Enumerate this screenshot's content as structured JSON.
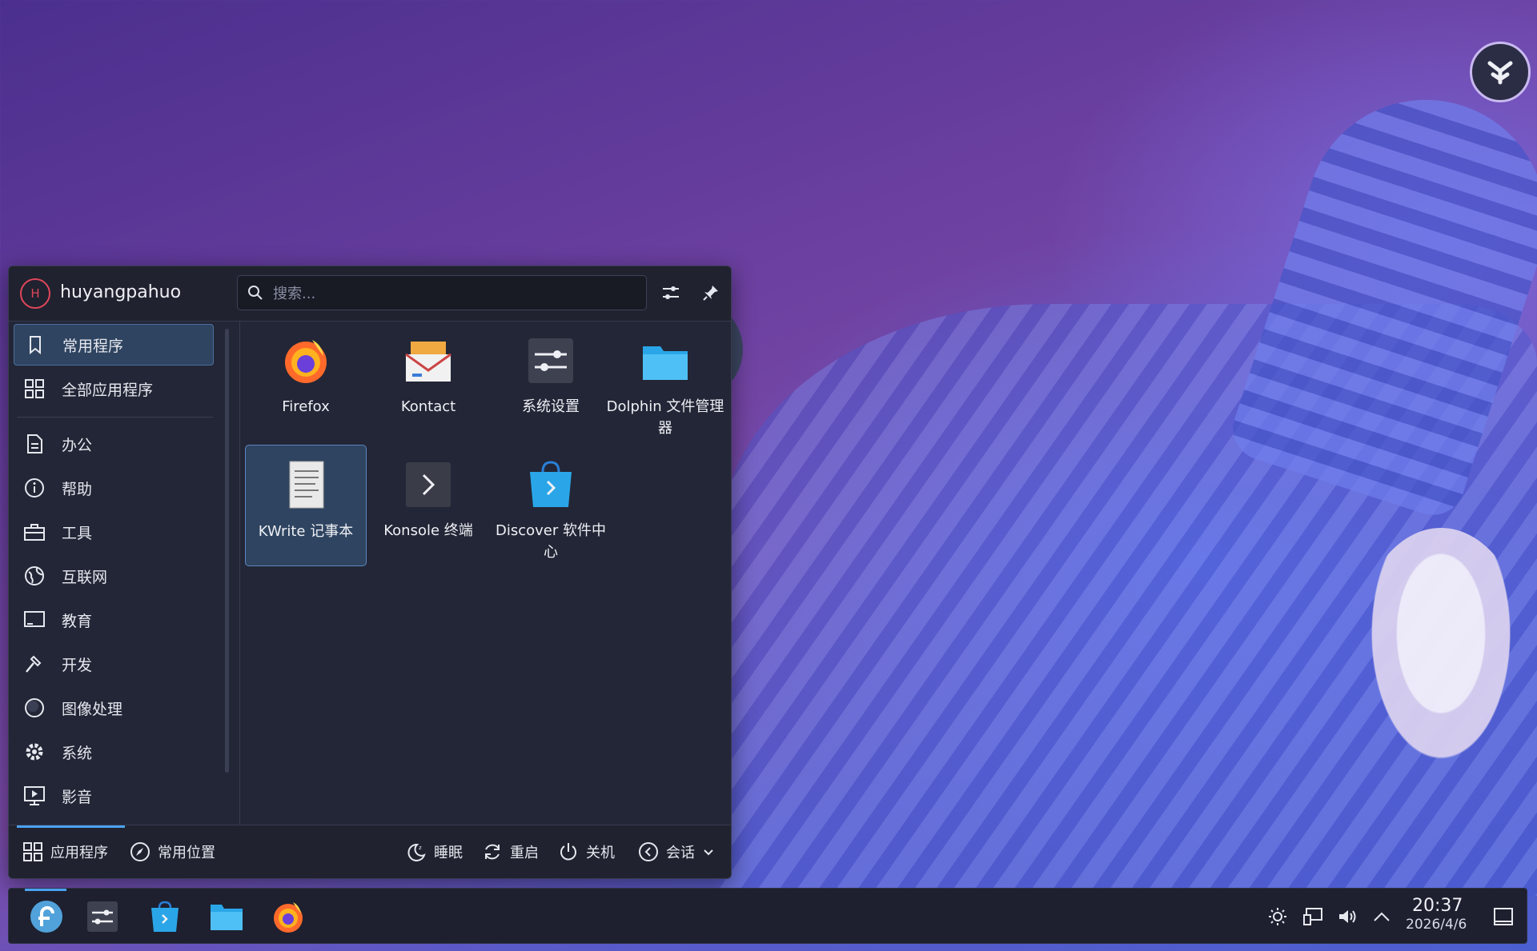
{
  "launcher": {
    "username": "huyangpahuo",
    "avatar_initial": "H",
    "search_placeholder": "搜索...",
    "sidebar": [
      {
        "label": "常用程序",
        "icon": "bookmark-icon",
        "active": true
      },
      {
        "label": "全部应用程序",
        "icon": "grid-icon"
      },
      {
        "label": "办公",
        "icon": "document-icon"
      },
      {
        "label": "帮助",
        "icon": "info-icon"
      },
      {
        "label": "工具",
        "icon": "toolbox-icon"
      },
      {
        "label": "互联网",
        "icon": "globe-icon"
      },
      {
        "label": "教育",
        "icon": "monitor-icon"
      },
      {
        "label": "开发",
        "icon": "hammer-icon"
      },
      {
        "label": "图像处理",
        "icon": "image-icon"
      },
      {
        "label": "系统",
        "icon": "gear-icon"
      },
      {
        "label": "影音",
        "icon": "media-icon"
      }
    ],
    "apps": [
      {
        "label": "Firefox",
        "icon": "firefox-icon"
      },
      {
        "label": "Kontact",
        "icon": "kontact-icon"
      },
      {
        "label": "系统设置",
        "icon": "settings-icon"
      },
      {
        "label": "Dolphin 文件管理器",
        "icon": "dolphin-icon"
      },
      {
        "label": "KWrite 记事本",
        "icon": "kwrite-icon",
        "selected": true
      },
      {
        "label": "Konsole 终端",
        "icon": "konsole-icon"
      },
      {
        "label": "Discover 软件中心",
        "icon": "discover-icon"
      }
    ],
    "footer": {
      "tab_apps": "应用程序",
      "tab_places": "常用位置",
      "sleep": "睡眠",
      "restart": "重启",
      "shutdown": "关机",
      "session": "会话"
    }
  },
  "taskbar": {
    "pinned": [
      "fedora-launcher-icon",
      "system-settings-icon",
      "discover-icon",
      "dolphin-icon",
      "firefox-icon"
    ],
    "clock_time": "20:37",
    "clock_date": "2026/4/6"
  },
  "colors": {
    "accent": "#4aa3f0",
    "selection_bg": "#2f4460",
    "panel_bg": "#232636",
    "avatar_ring": "#e0465a"
  }
}
